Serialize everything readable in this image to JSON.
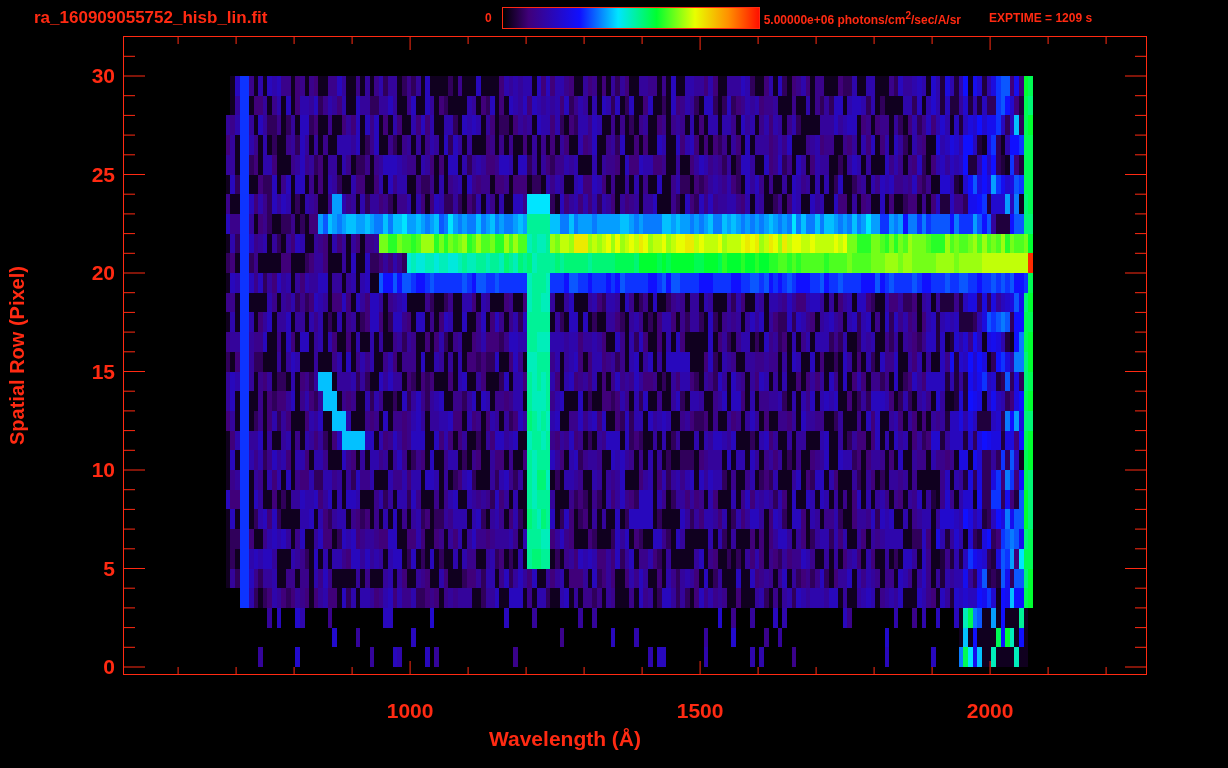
{
  "title": "ra_160909055752_hisb_lin.fit",
  "colorbar": {
    "min_label": "0",
    "max_label": "5.00000e+06 photons/cm$^{2}$/sec/A/sr"
  },
  "exposure": "EXPTIME = 1209 s",
  "plot": {
    "xlabel": "Wavelength (Å)",
    "ylabel": "Spatial Row (Pixel)",
    "xticks": [
      "1000",
      "1500",
      "2000"
    ],
    "yticks": [
      "30",
      "25",
      "20",
      "15",
      "10",
      "5",
      "0"
    ]
  }
}
